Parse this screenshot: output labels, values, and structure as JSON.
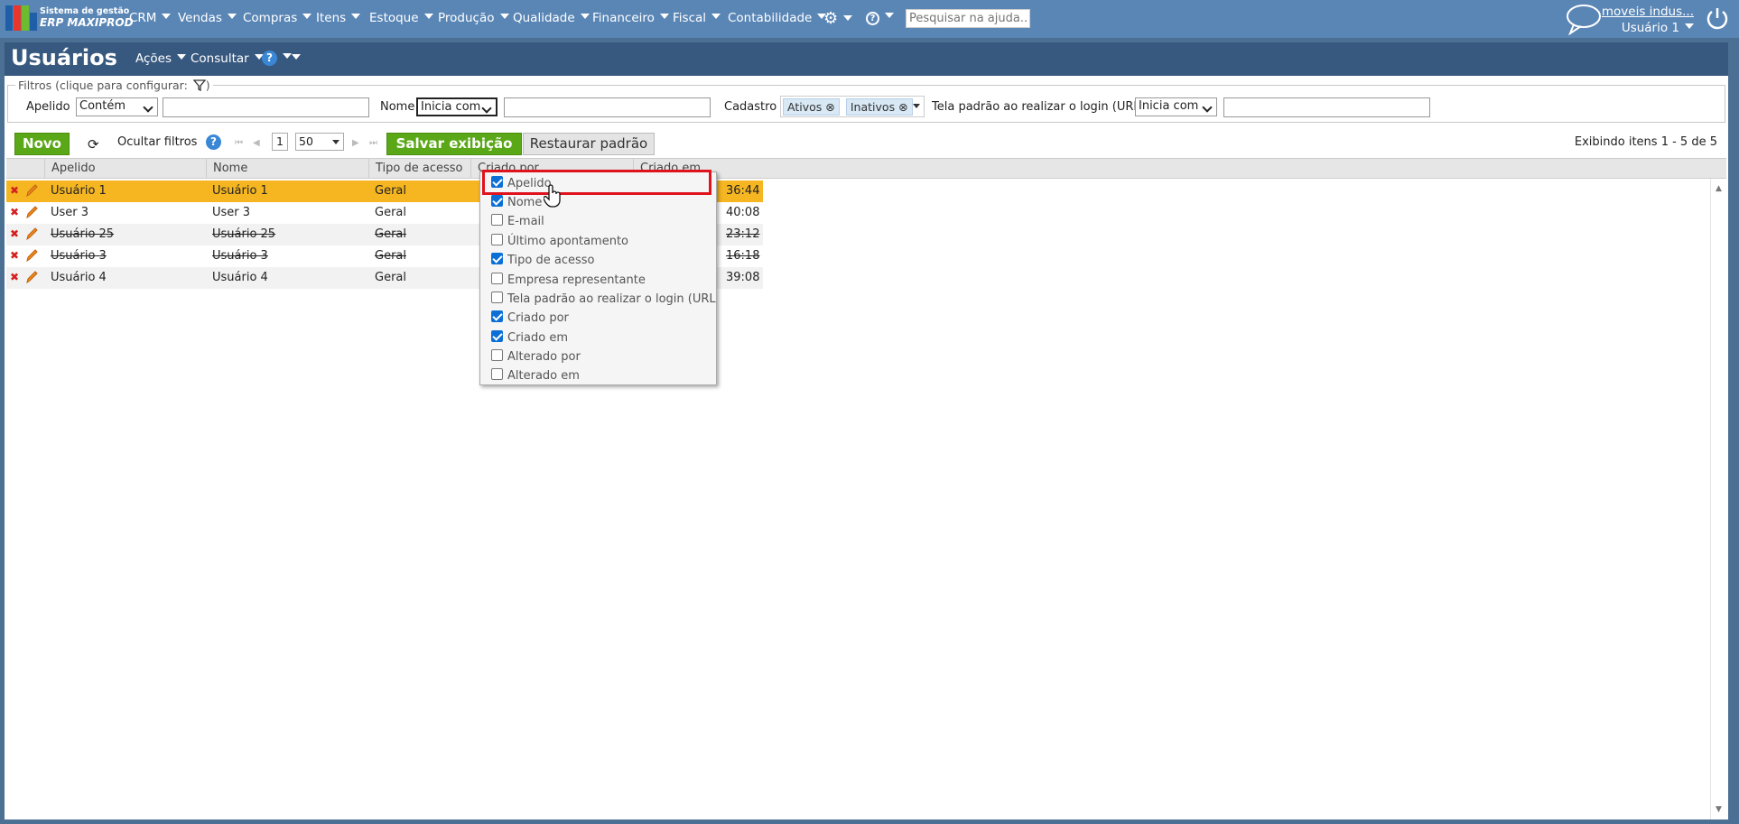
{
  "topbar": {
    "logo_line1": "Sistema de gestão",
    "logo_line2": "ERP MAXIPROD",
    "menu": [
      "CRM",
      "Vendas",
      "Compras",
      "Itens",
      "Estoque",
      "Produção",
      "Qualidade",
      "Financeiro",
      "Fiscal",
      "Contabilidade"
    ],
    "help_search_placeholder": "Pesquisar na ajuda...",
    "company": "moveis indus...",
    "user": "Usuário 1"
  },
  "page": {
    "title": "Usuários",
    "actions_menu": "Ações",
    "consult_menu": "Consultar"
  },
  "filters": {
    "legend": "Filtros (clique para configurar:",
    "apelido_label": "Apelido",
    "apelido_op": "Contém",
    "nome_label": "Nome",
    "nome_op": "Inicia com",
    "cadastro_label": "Cadastro",
    "cadastro_tags": [
      "Ativos",
      "Inativos"
    ],
    "tela_label": "Tela padrão ao realizar o login (URL)",
    "tela_op": "Inicia com"
  },
  "toolbar": {
    "new_label": "Novo",
    "hide_filters_label": "Ocultar filtros",
    "page_number": "1",
    "page_size": "50",
    "save_view_label": "Salvar exibição",
    "restore_label": "Restaurar padrão",
    "display_info": "Exibindo itens 1 - 5 de 5"
  },
  "grid": {
    "columns": [
      "Apelido",
      "Nome",
      "Tipo de acesso",
      "Criado por",
      "Criado em"
    ],
    "rows": [
      {
        "apelido": "Usuário 1",
        "nome": "Usuário 1",
        "tipo": "Geral",
        "criado_em": "36:44"
      },
      {
        "apelido": "User 3",
        "nome": "User 3",
        "tipo": "Geral",
        "criado_em": "40:08"
      },
      {
        "apelido": "Usuário 25",
        "nome": "Usuário 25",
        "tipo": "Geral",
        "criado_em": "23:12"
      },
      {
        "apelido": "Usuário 3",
        "nome": "Usuário 3",
        "tipo": "Geral",
        "criado_em": "16:18"
      },
      {
        "apelido": "Usuário 4",
        "nome": "Usuário 4",
        "tipo": "Geral",
        "criado_em": "39:08"
      }
    ]
  },
  "column_menu": {
    "options": [
      {
        "label": "Apelido",
        "checked": true
      },
      {
        "label": "Nome",
        "checked": true
      },
      {
        "label": "E-mail",
        "checked": false
      },
      {
        "label": "Último apontamento",
        "checked": false
      },
      {
        "label": "Tipo de acesso",
        "checked": true
      },
      {
        "label": "Empresa representante",
        "checked": false
      },
      {
        "label": "Tela padrão ao realizar o login (URL)",
        "checked": false
      },
      {
        "label": "Criado por",
        "checked": true
      },
      {
        "label": "Criado em",
        "checked": true
      },
      {
        "label": "Alterado por",
        "checked": false
      },
      {
        "label": "Alterado em",
        "checked": false
      }
    ]
  },
  "colors": {
    "topbar": "#5a86b6",
    "title_bar": "#38597f",
    "selected_row": "#f5b622",
    "green_button": "#5aa817",
    "highlight": "#e0131d"
  }
}
